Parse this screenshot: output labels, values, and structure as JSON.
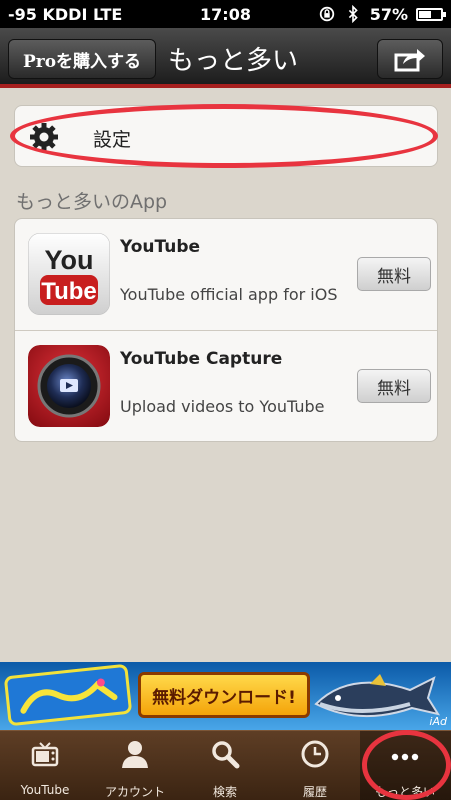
{
  "status_bar": {
    "carrier": "-95 KDDI  LTE",
    "time": "17:08",
    "battery": "57%",
    "battery_level": 0.57
  },
  "nav_bar": {
    "pro_button_label": "Proを購入する",
    "title": "もっと多い",
    "share_icon": "share-icon"
  },
  "settings": {
    "label": "設定",
    "icon": "gear-icon"
  },
  "more_apps": {
    "section_title": "もっと多いのApp",
    "apps": [
      {
        "name": "YouTube",
        "description": "YouTube official app for iOS",
        "price": "無料",
        "icon": "youtube-icon"
      },
      {
        "name": "YouTube Capture",
        "description": "Upload videos to YouTube",
        "price": "無料",
        "icon": "youtube-capture-icon"
      }
    ]
  },
  "ad_banner": {
    "cta": "無料ダウンロード!",
    "iad_label": "iAd"
  },
  "tab_bar": {
    "tabs": [
      {
        "label": "YouTube",
        "icon": "tv-icon"
      },
      {
        "label": "アカウント",
        "icon": "person-icon"
      },
      {
        "label": "検索",
        "icon": "search-icon"
      },
      {
        "label": "履歴",
        "icon": "clock-icon"
      },
      {
        "label": "もっと多い",
        "icon": "more-icon"
      }
    ]
  },
  "colors": {
    "accent_red": "#a7201f",
    "annotation_red": "#e8343f",
    "background": "#dbd6cc",
    "tab_bar": "#4a2f1a"
  }
}
